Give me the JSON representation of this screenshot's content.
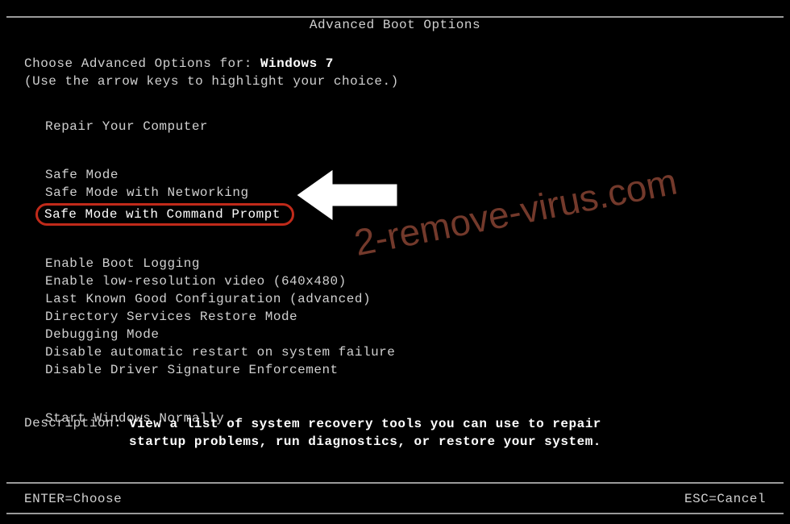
{
  "title": "Advanced Boot Options",
  "prompt": {
    "prefix": "Choose Advanced Options for:",
    "os": "Windows 7",
    "hint": "(Use the arrow keys to highlight your choice.)"
  },
  "groups": [
    {
      "items": [
        {
          "label": "Repair Your Computer",
          "highlight": false
        }
      ]
    },
    {
      "items": [
        {
          "label": "Safe Mode",
          "highlight": false
        },
        {
          "label": "Safe Mode with Networking",
          "highlight": false
        },
        {
          "label": "Safe Mode with Command Prompt",
          "highlight": true
        }
      ]
    },
    {
      "items": [
        {
          "label": "Enable Boot Logging",
          "highlight": false
        },
        {
          "label": "Enable low-resolution video (640x480)",
          "highlight": false
        },
        {
          "label": "Last Known Good Configuration (advanced)",
          "highlight": false
        },
        {
          "label": "Directory Services Restore Mode",
          "highlight": false
        },
        {
          "label": "Debugging Mode",
          "highlight": false
        },
        {
          "label": "Disable automatic restart on system failure",
          "highlight": false
        },
        {
          "label": "Disable Driver Signature Enforcement",
          "highlight": false
        }
      ]
    },
    {
      "items": [
        {
          "label": "Start Windows Normally",
          "highlight": false
        }
      ]
    }
  ],
  "description": {
    "label": "Description:",
    "text_line1": "View a list of system recovery tools you can use to repair",
    "text_line2": "startup problems, run diagnostics, or restore your system."
  },
  "footer": {
    "enter": "ENTER=Choose",
    "esc": "ESC=Cancel"
  },
  "watermark": "2-remove-virus.com"
}
